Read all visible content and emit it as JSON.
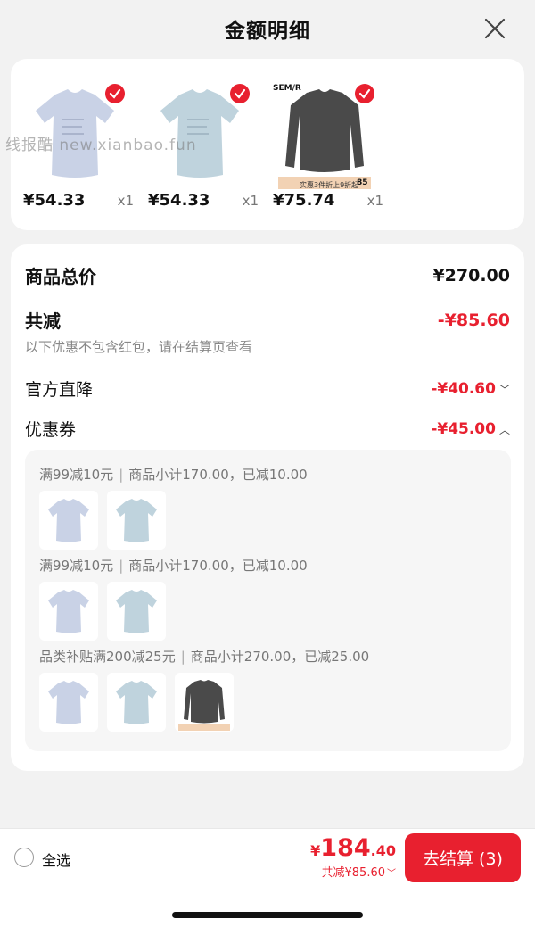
{
  "header": {
    "title": "金额明细",
    "close_icon": "close-icon"
  },
  "watermark": "线报酷 new.xianbao.fun",
  "products": [
    {
      "kind": "tee",
      "color": "#c9d2e6",
      "price": "¥54.33",
      "qty": "x1"
    },
    {
      "kind": "tee",
      "color": "#bfd3dd",
      "price": "¥54.33",
      "qty": "x1"
    },
    {
      "kind": "cardigan",
      "color": "#5a5a5a",
      "price": "¥75.74",
      "qty": "x1",
      "brand": "SEM/R",
      "banner": "实惠3件折上9折起",
      "banner_num": "85"
    }
  ],
  "summary": {
    "total_label": "商品总价",
    "total_value": "¥270.00",
    "discount_label": "共减",
    "discount_value": "-¥85.60",
    "note": "以下优惠不包含红包，请在结算页查看",
    "official_label": "官方直降",
    "official_value": "-¥40.60",
    "coupon_label": "优惠券",
    "coupon_value": "-¥45.00"
  },
  "coupons": [
    {
      "title": "满99减10元",
      "detail": "商品小计170.00，已减10.00"
    },
    {
      "title": "满99减10元",
      "detail": "商品小计170.00，已减10.00"
    },
    {
      "title": "品类补贴满200减25元",
      "detail": "商品小计270.00，已减25.00"
    }
  ],
  "bottom": {
    "select_all": "全选",
    "total_yen": "¥",
    "total_int": "184",
    "total_dec": ".40",
    "saved": "共减¥85.60",
    "checkout": "去结算 (3)"
  },
  "colors": {
    "accent": "#e8202f"
  }
}
